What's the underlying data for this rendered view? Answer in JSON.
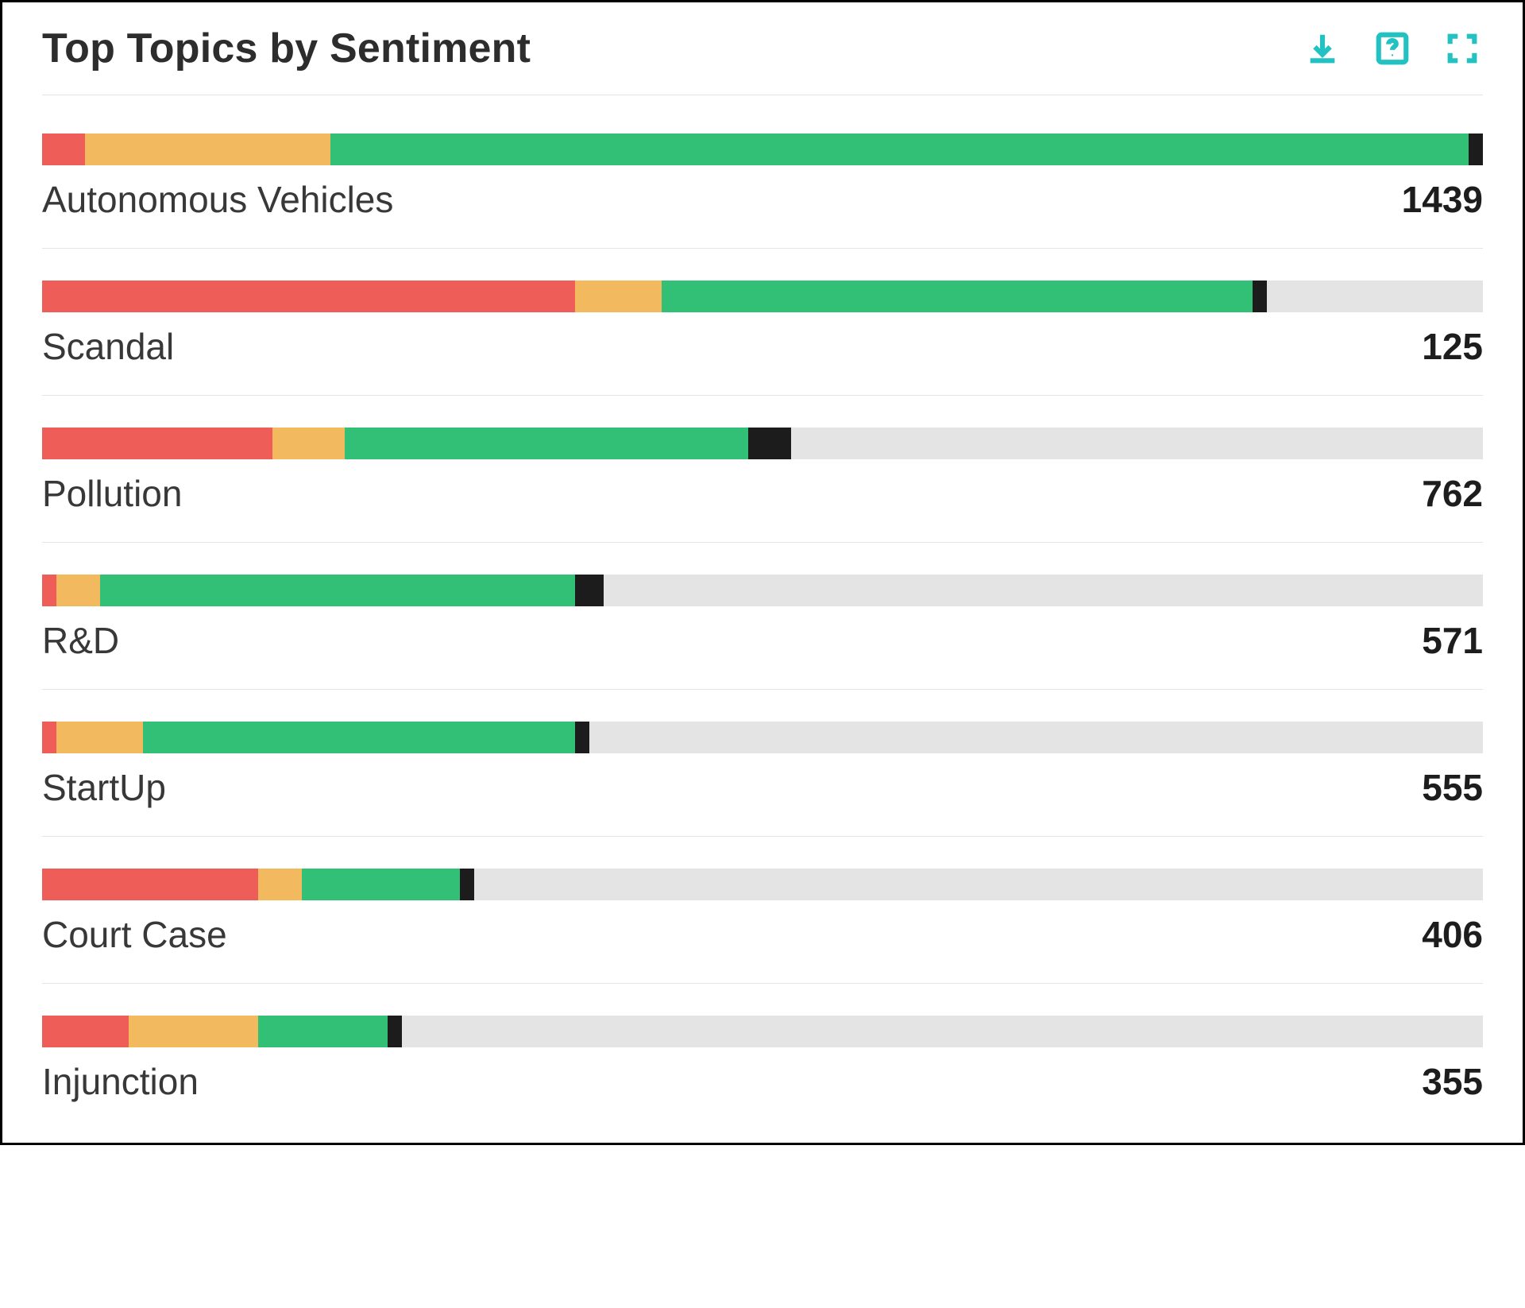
{
  "header": {
    "title": "Top Topics by Sentiment"
  },
  "colors": {
    "negative": "#ef5d58",
    "warning": "#f3b95e",
    "positive": "#31c075",
    "other": "#1c1c1c",
    "track": "#e4e4e4",
    "accent": "#22c2c2"
  },
  "chart_data": {
    "type": "bar",
    "title": "Top Topics by Sentiment",
    "xlabel": "",
    "ylabel": "",
    "note": "Each bar is a stacked sentiment breakdown. 'total' is the numeric label shown to the right. 'segments' are percent of full bar width; remainder is empty track.",
    "series_order": [
      "negative",
      "warning",
      "positive",
      "other"
    ],
    "rows": [
      {
        "label": "Autonomous Vehicles",
        "total": 1439,
        "segments": {
          "negative": 3,
          "warning": 17,
          "positive": 79,
          "other": 1
        }
      },
      {
        "label": "Scandal",
        "total": 125,
        "segments": {
          "negative": 37,
          "warning": 6,
          "positive": 41,
          "other": 1
        }
      },
      {
        "label": "Pollution",
        "total": 762,
        "segments": {
          "negative": 16,
          "warning": 5,
          "positive": 28,
          "other": 3
        }
      },
      {
        "label": "R&D",
        "total": 571,
        "segments": {
          "negative": 1,
          "warning": 3,
          "positive": 33,
          "other": 2
        }
      },
      {
        "label": "StartUp",
        "total": 555,
        "segments": {
          "negative": 1,
          "warning": 6,
          "positive": 30,
          "other": 1
        }
      },
      {
        "label": "Court Case",
        "total": 406,
        "segments": {
          "negative": 15,
          "warning": 3,
          "positive": 11,
          "other": 1
        }
      },
      {
        "label": "Injunction",
        "total": 355,
        "segments": {
          "negative": 6,
          "warning": 9,
          "positive": 9,
          "other": 1
        }
      }
    ]
  }
}
